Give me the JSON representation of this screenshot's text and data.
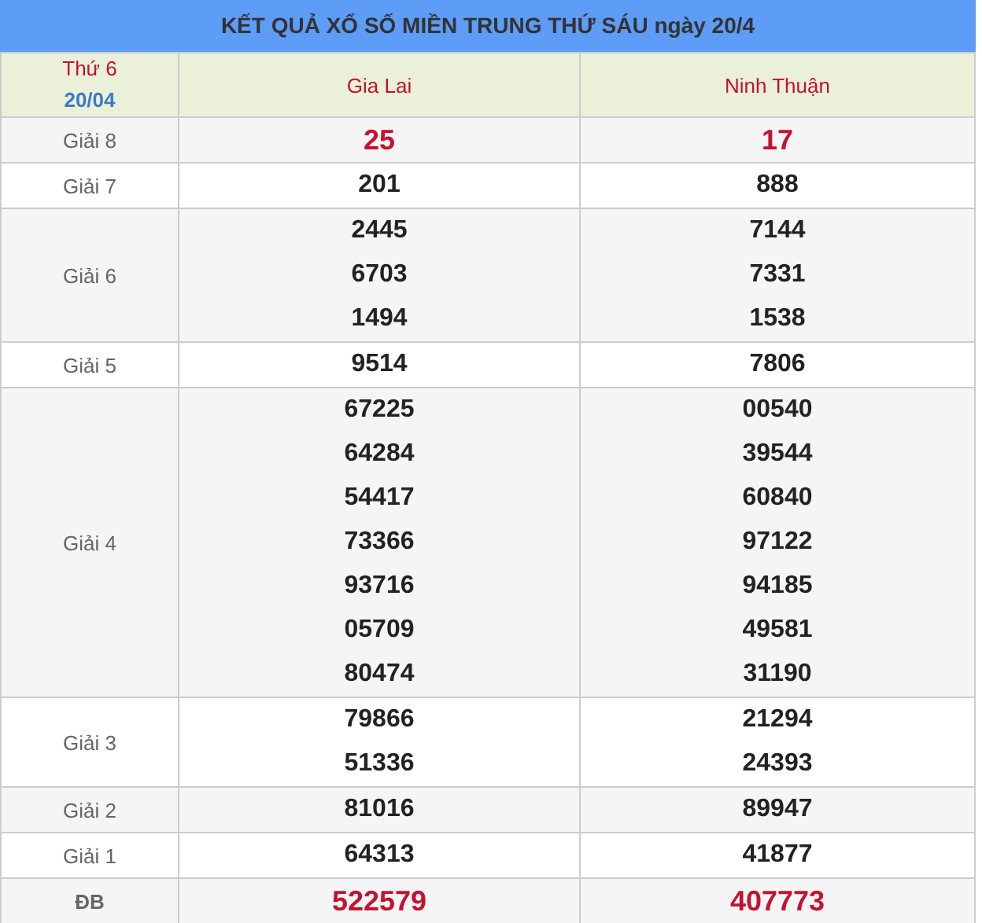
{
  "title": "KẾT QUẢ XỔ SỐ MIỀN TRUNG THỨ SÁU ngày 20/4",
  "header": {
    "day": "Thứ 6",
    "date": "20/04",
    "provinces": [
      "Gia Lai",
      "Ninh Thuận"
    ]
  },
  "rows": [
    {
      "label": "Giải 8",
      "kind": "highlight",
      "results": [
        [
          "25"
        ],
        [
          "17"
        ]
      ]
    },
    {
      "label": "Giải 7",
      "kind": "normal",
      "results": [
        [
          "201"
        ],
        [
          "888"
        ]
      ]
    },
    {
      "label": "Giải 6",
      "kind": "normal",
      "results": [
        [
          "2445",
          "6703",
          "1494"
        ],
        [
          "7144",
          "7331",
          "1538"
        ]
      ]
    },
    {
      "label": "Giải 5",
      "kind": "normal",
      "results": [
        [
          "9514"
        ],
        [
          "7806"
        ]
      ]
    },
    {
      "label": "Giải 4",
      "kind": "normal",
      "results": [
        [
          "67225",
          "64284",
          "54417",
          "73366",
          "93716",
          "05709",
          "80474"
        ],
        [
          "00540",
          "39544",
          "60840",
          "97122",
          "94185",
          "49581",
          "31190"
        ]
      ]
    },
    {
      "label": "Giải 3",
      "kind": "normal",
      "results": [
        [
          "79866",
          "51336"
        ],
        [
          "21294",
          "24393"
        ]
      ]
    },
    {
      "label": "Giải 2",
      "kind": "normal",
      "results": [
        [
          "81016"
        ],
        [
          "89947"
        ]
      ]
    },
    {
      "label": "Giải 1",
      "kind": "normal",
      "results": [
        [
          "64313"
        ],
        [
          "41877"
        ]
      ]
    },
    {
      "label": "ĐB",
      "kind": "special",
      "results": [
        [
          "522579"
        ],
        [
          "407773"
        ]
      ]
    }
  ]
}
